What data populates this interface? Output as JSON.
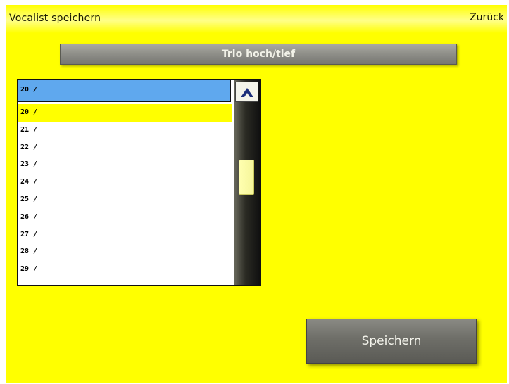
{
  "header": {
    "title": "Vocalist speichern",
    "back_label": "Zurück"
  },
  "preset": {
    "name": "Trio hoch/tief"
  },
  "list": {
    "selected_header": "20 /",
    "rows": [
      "20 /",
      "21 /",
      "22 /",
      "23 /",
      "24 /",
      "25 /",
      "26 /",
      "27 /",
      "28 /",
      "29 /"
    ],
    "selected_index": 0
  },
  "scrollbar": {
    "position": 0.4
  },
  "actions": {
    "save_label": "Speichern"
  },
  "colors": {
    "background": "#ffff00",
    "header_highlight": "#5fa8ee",
    "selection": "#ffff00"
  }
}
